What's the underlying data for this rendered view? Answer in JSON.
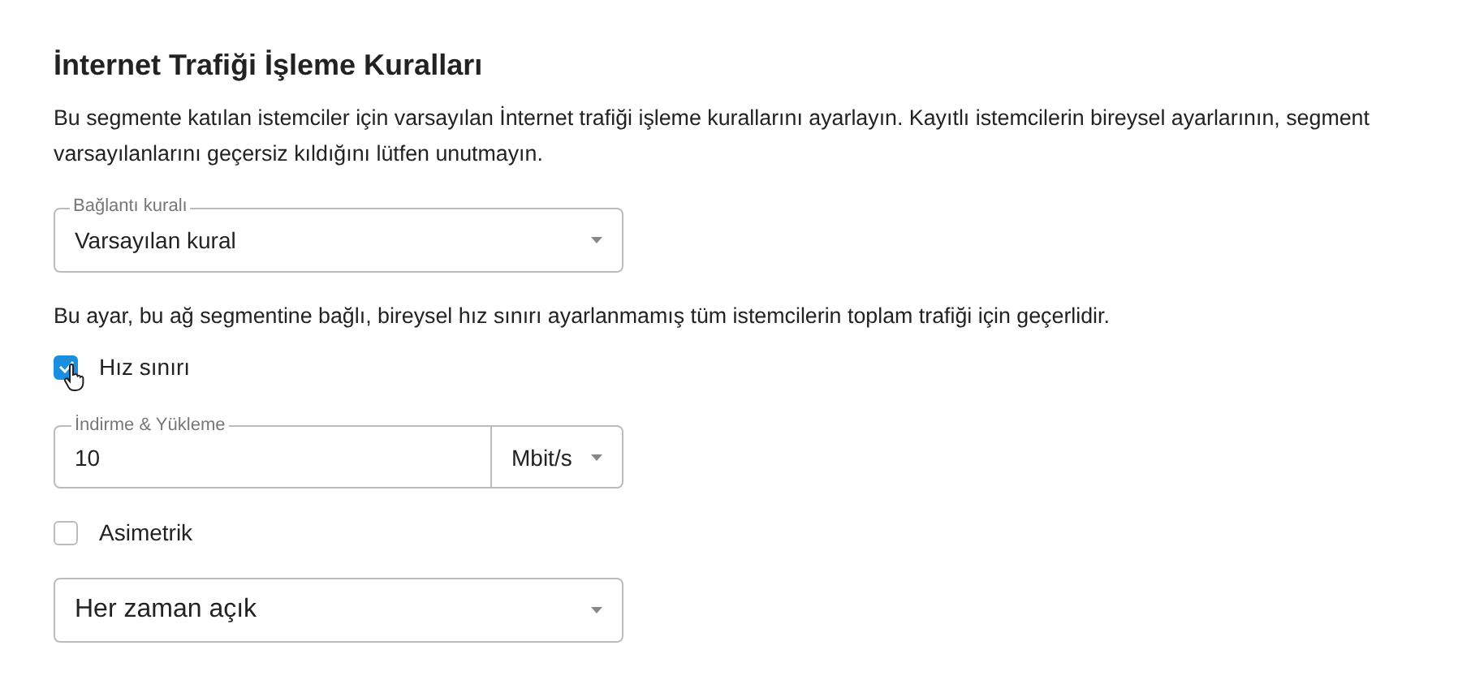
{
  "title": "İnternet Trafiği İşleme Kuralları",
  "description": "Bu segmente katılan istemciler için varsayılan İnternet trafiği işleme kurallarını ayarlayın. Kayıtlı istemcilerin bireysel ayarlarının, segment varsayılanlarını geçersiz kıldığını lütfen unutmayın.",
  "connection_rule": {
    "label": "Bağlantı kuralı",
    "value": "Varsayılan kural"
  },
  "note": "Bu ayar, bu ağ segmentine bağlı, bireysel hız sınırı ayarlanmamış tüm istemcilerin toplam trafiği için geçerlidir.",
  "speed_limit": {
    "label": "Hız sınırı",
    "checked": true
  },
  "rate": {
    "label": "İndirme & Yükleme",
    "value": "10",
    "unit": "Mbit/s"
  },
  "asymmetric": {
    "label": "Asimetrik",
    "checked": false
  },
  "schedule": {
    "value": "Her zaman açık"
  }
}
